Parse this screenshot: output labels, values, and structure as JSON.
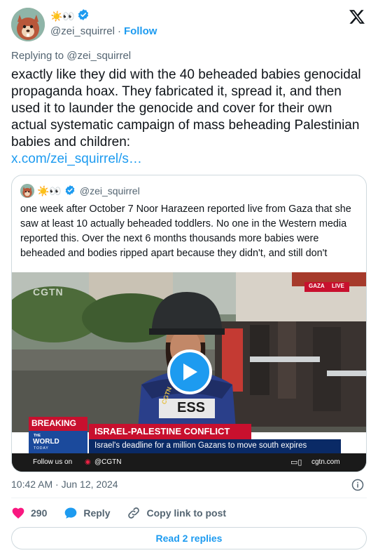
{
  "author": {
    "display_name_emoji": "☀️👀",
    "handle": "@zei_squirrel",
    "separator": "·",
    "follow_label": "Follow"
  },
  "replying_to": "Replying to @zei_squirrel",
  "tweet": {
    "text": "exactly like they did with the 40 beheaded babies genocidal propaganda hoax. They fabricated it, spread it, and then used it to launder the genocide and cover for their own actual systematic campaign of mass beheading Palestinian babies and children:",
    "link": "x.com/zei_squirrel/s…"
  },
  "quoted": {
    "display_name_emoji": "☀️👀",
    "handle": "@zei_squirrel",
    "text": "one week after October 7 Noor Harazeen reported live from Gaza that she saw at least 10 actually beheaded toddlers. No one in the Western media reported this. Over the next 6 months thousands more babies were beheaded and bodies ripped apart because they didn't, and still don't",
    "video": {
      "channel_logo": "CGTN",
      "location_tag": "GAZA",
      "live_tag": "LIVE",
      "press_text": "ESS",
      "vest_text": "CGTN",
      "breaking": "BREAKING",
      "show_name_top": "THE",
      "show_name": "WORLD",
      "show_name_bottom": "TODAY",
      "headline": "ISRAEL-PALESTINE CONFLICT",
      "subheadline": "Israel's deadline for a million Gazans to move south expires",
      "follow_us": "Follow us on",
      "social_handle": "@CGTN",
      "website": "cgtn.com"
    }
  },
  "timestamp": "10:42 AM · Jun 12, 2024",
  "actions": {
    "likes": "290",
    "reply_label": "Reply",
    "copy_label": "Copy link to post"
  },
  "read_replies": "Read 2 replies",
  "colors": {
    "accent": "#1d9bf0",
    "like": "#f91880",
    "muted": "#536471",
    "text": "#0f1419",
    "border": "#cfd9de",
    "breaking_red": "#c8102e"
  }
}
